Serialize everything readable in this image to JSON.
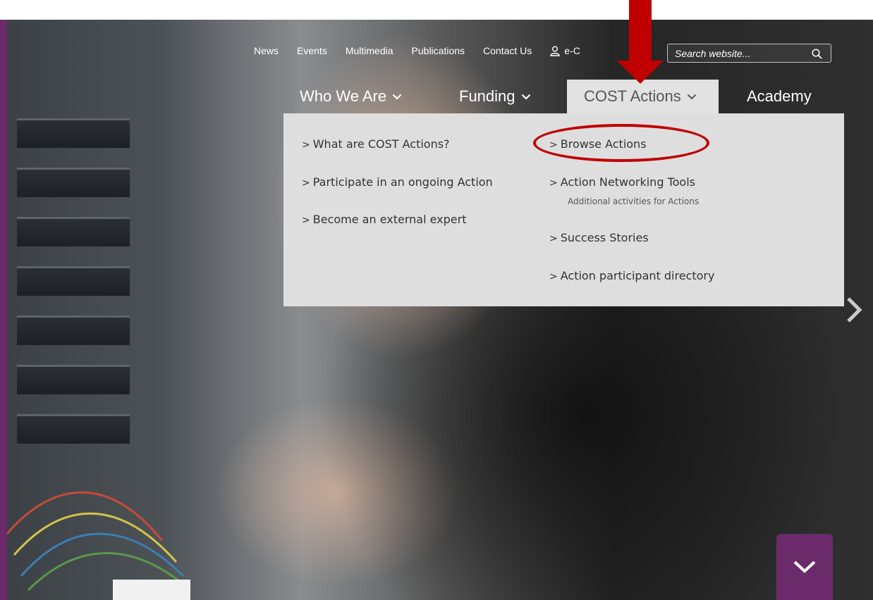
{
  "utility_nav": {
    "items": [
      "News",
      "Events",
      "Multimedia",
      "Publications",
      "Contact Us"
    ],
    "ecost_label": "e-C",
    "search_placeholder": "Search website..."
  },
  "main_nav": {
    "who_we_are": "Who We Are",
    "funding": "Funding",
    "cost_actions": "COST Actions",
    "academy": "Academy"
  },
  "dropdown": {
    "left": [
      "What are COST Actions?",
      "Participate in an ongoing Action",
      "Become an external expert"
    ],
    "right": {
      "browse_actions": "Browse Actions",
      "networking_tools": "Action Networking Tools",
      "networking_tools_sub": "Additional activities for Actions",
      "success_stories": "Success Stories",
      "participant_directory": "Action participant directory"
    }
  },
  "colors": {
    "brand_purple": "#6b2b6b",
    "dropdown_bg": "#dedede",
    "annotation_red": "#c00000"
  },
  "icons": {
    "user": "user-icon",
    "search": "search-icon",
    "chevron_down": "chevron-down-icon",
    "chevron_right": "chevron-right-icon"
  }
}
